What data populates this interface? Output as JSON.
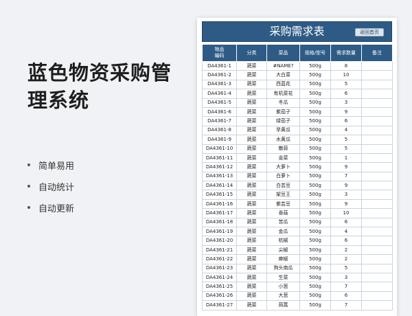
{
  "promo": {
    "title": "蓝色物资采购管理系统",
    "features": [
      "简单易用",
      "自动统计",
      "自动更新"
    ]
  },
  "sheet": {
    "title": "采购需求表",
    "home_button": "返回首页",
    "header_color": "#2e5b85",
    "columns": [
      "物品\n编码",
      "分类",
      "菜品",
      "规格/型号",
      "需求数量",
      "备注"
    ],
    "rows": [
      [
        "DA4361-1",
        "蔬菜",
        "#NAME?",
        "500g",
        "8",
        ""
      ],
      [
        "DA4361-2",
        "蔬菜",
        "大白菜",
        "500g",
        "10",
        ""
      ],
      [
        "DA4361-3",
        "蔬菜",
        "西蓝花",
        "500g",
        "5",
        ""
      ],
      [
        "DA4361-4",
        "蔬菜",
        "有机菜花",
        "500g",
        "6",
        ""
      ],
      [
        "DA4361-5",
        "蔬菜",
        "冬瓜",
        "500g",
        "3",
        ""
      ],
      [
        "DA4361-6",
        "蔬菜",
        "紫茄子",
        "500g",
        "9",
        ""
      ],
      [
        "DA4361-7",
        "蔬菜",
        "绿茄子",
        "500g",
        "6",
        ""
      ],
      [
        "DA4361-8",
        "蔬菜",
        "旱黄瓜",
        "500g",
        "4",
        ""
      ],
      [
        "DA4361-9",
        "蔬菜",
        "水黄瓜",
        "500g",
        "5",
        ""
      ],
      [
        "DA4361-10",
        "蔬菜",
        "散蒜",
        "500g",
        "5",
        ""
      ],
      [
        "DA4361-11",
        "蔬菜",
        "韭菜",
        "500g",
        "1",
        ""
      ],
      [
        "DA4361-12",
        "蔬菜",
        "大萝卜",
        "500g",
        "9",
        ""
      ],
      [
        "DA4361-13",
        "蔬菜",
        "白萝卜",
        "500g",
        "7",
        ""
      ],
      [
        "DA4361-14",
        "蔬菜",
        "白芸豆",
        "500g",
        "9",
        ""
      ],
      [
        "DA4361-15",
        "蔬菜",
        "架豆王",
        "500g",
        "3",
        ""
      ],
      [
        "DA4361-16",
        "蔬菜",
        "紫芸豆",
        "500g",
        "9",
        ""
      ],
      [
        "DA4361-17",
        "蔬菜",
        "香菇",
        "500g",
        "10",
        ""
      ],
      [
        "DA4361-18",
        "蔬菜",
        "苦瓜",
        "500g",
        "6",
        ""
      ],
      [
        "DA4361-19",
        "蔬菜",
        "金瓜",
        "500g",
        "4",
        ""
      ],
      [
        "DA4361-20",
        "蔬菜",
        "杭椒",
        "500g",
        "6",
        ""
      ],
      [
        "DA4361-21",
        "蔬菜",
        "尖椒",
        "500g",
        "2",
        ""
      ],
      [
        "DA4361-22",
        "蔬菜",
        "麻椒",
        "500g",
        "2",
        ""
      ],
      [
        "DA4361-23",
        "蔬菜",
        "狗头南瓜",
        "500g",
        "5",
        ""
      ],
      [
        "DA4361-24",
        "蔬菜",
        "生菜",
        "500g",
        "3",
        ""
      ],
      [
        "DA4361-25",
        "蔬菜",
        "小葱",
        "500g",
        "7",
        ""
      ],
      [
        "DA4361-26",
        "蔬菜",
        "大葱",
        "500g",
        "6",
        ""
      ],
      [
        "DA4361-27",
        "蔬菜",
        "茼蒿",
        "500g",
        "7",
        ""
      ]
    ]
  }
}
